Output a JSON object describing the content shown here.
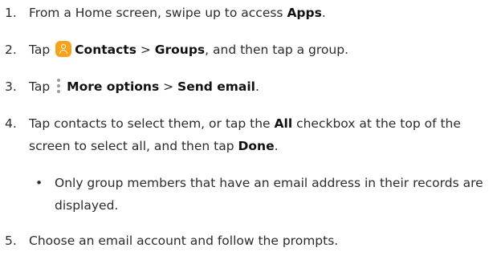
{
  "steps": [
    {
      "number": "1.",
      "text_before": "From a Home screen, swipe up to access ",
      "bold_1": "Apps",
      "text_after": "."
    },
    {
      "number": "2.",
      "text_before": "Tap ",
      "icon": "contacts-icon",
      "bold_1": "Contacts",
      "separator": " > ",
      "bold_2": "Groups",
      "text_after": ", and then tap a group."
    },
    {
      "number": "3.",
      "text_before": "Tap ",
      "icon": "more-options-icon",
      "bold_1": "More options",
      "separator": " > ",
      "bold_2": "Send email",
      "text_after": "."
    },
    {
      "number": "4.",
      "text_before": "Tap contacts to select them, or tap the ",
      "bold_1": "All",
      "text_middle": " checkbox at the top of the screen to select all, and then tap ",
      "bold_2": "Done",
      "text_after": "."
    },
    {
      "number": "5.",
      "text": "Choose an email account and follow the prompts."
    }
  ],
  "note": {
    "bullet": "•",
    "text": "Only group members that have an email address in their records are displayed."
  },
  "colors": {
    "text": "#2b2b2b",
    "contacts_icon": "#f7a21b",
    "more_icon": "#9a9a9a"
  }
}
